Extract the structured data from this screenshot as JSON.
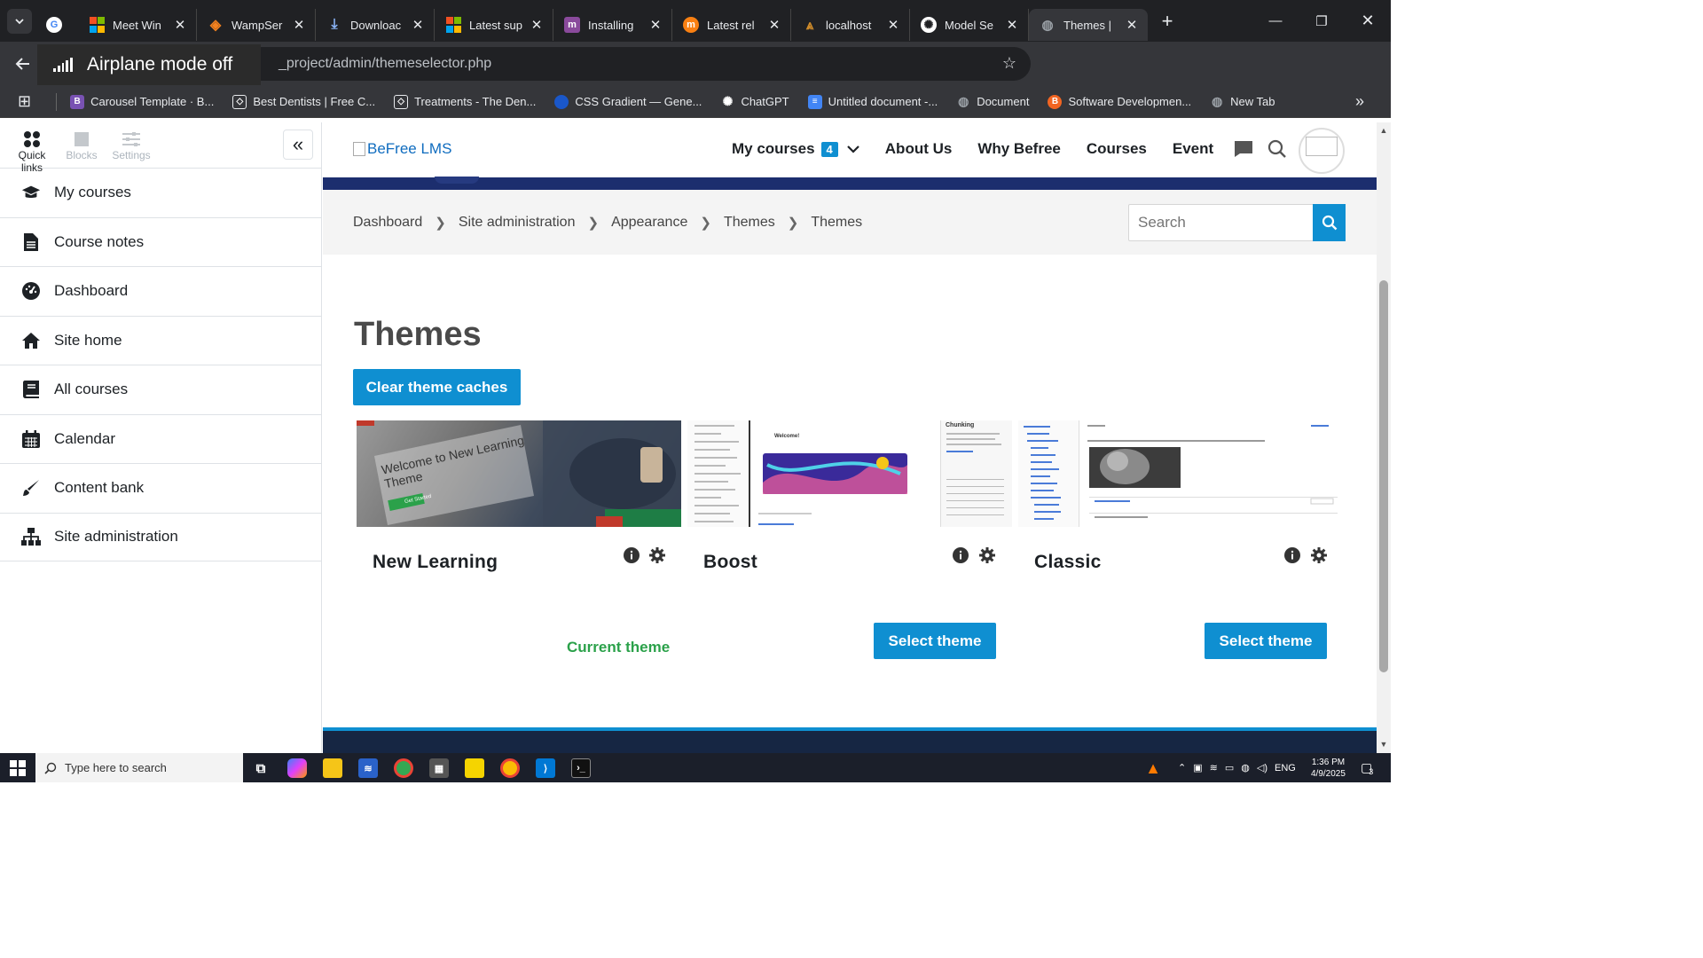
{
  "browser": {
    "tabs": [
      {
        "title": "Meet Win",
        "icon": "microsoft-icon",
        "color": "#f25022"
      },
      {
        "title": "WampSer",
        "icon": "wamp-icon",
        "color": "#f5821f"
      },
      {
        "title": "Downloac",
        "icon": "download-icon",
        "color": "#8ab4f8"
      },
      {
        "title": "Latest sup",
        "icon": "microsoft-icon",
        "color": "#7fba00"
      },
      {
        "title": "Installing",
        "icon": "moodle-icon",
        "color": "#8a4a9c"
      },
      {
        "title": "Latest rel",
        "icon": "moodle-icon",
        "color": "#f98012"
      },
      {
        "title": "localhost",
        "icon": "localhost-icon",
        "color": "#d08c2a"
      },
      {
        "title": "Model Se",
        "icon": "openai-icon",
        "color": "#ffffff"
      },
      {
        "title": "Themes |",
        "icon": "globe-icon",
        "color": "#9aa0a6",
        "active": true
      }
    ],
    "url": "_project/admin/themeselector.php",
    "airplane_toast": "Airplane mode off",
    "bookmarks": [
      {
        "label": "Carousel Template · B...",
        "color": "#7952b3",
        "glyph": "B"
      },
      {
        "label": "Best Dentists | Free C...",
        "color": "#ffffff",
        "glyph": "◇"
      },
      {
        "label": "Treatments - The Den...",
        "color": "#ffffff",
        "glyph": "◇"
      },
      {
        "label": "CSS Gradient — Gene...",
        "color": "#1a57c9",
        "glyph": ""
      },
      {
        "label": "ChatGPT",
        "color": "#ffffff",
        "glyph": "✺"
      },
      {
        "label": "Untitled document -...",
        "color": "#4285f4",
        "glyph": "≡"
      },
      {
        "label": "Document",
        "color": "#9aa0a6",
        "glyph": "◍"
      },
      {
        "label": "Software Developmen...",
        "color": "#f26522",
        "glyph": "B"
      },
      {
        "label": "New Tab",
        "color": "#9aa0a6",
        "glyph": "◍"
      }
    ]
  },
  "drawer": {
    "tabs": [
      {
        "label": "Quick links",
        "active": true
      },
      {
        "label": "Blocks"
      },
      {
        "label": "Settings"
      }
    ],
    "items": [
      {
        "label": "My courses",
        "icon": "graduation-cap-icon"
      },
      {
        "label": "Course notes",
        "icon": "document-icon"
      },
      {
        "label": "Dashboard",
        "icon": "dashboard-gauge-icon"
      },
      {
        "label": "Site home",
        "icon": "home-icon"
      },
      {
        "label": "All courses",
        "icon": "book-icon"
      },
      {
        "label": "Calendar",
        "icon": "calendar-icon"
      },
      {
        "label": "Content bank",
        "icon": "brush-icon"
      },
      {
        "label": "Site administration",
        "icon": "sitemap-icon"
      }
    ]
  },
  "navbar": {
    "logo_alt": "BeFree LMS",
    "links": [
      {
        "label": "My courses",
        "badge": "4",
        "dropdown": true
      },
      {
        "label": "About Us"
      },
      {
        "label": "Why Befree"
      },
      {
        "label": "Courses"
      },
      {
        "label": "Event"
      }
    ]
  },
  "breadcrumb": [
    "Dashboard",
    "Site administration",
    "Appearance",
    "Themes",
    "Themes"
  ],
  "search": {
    "placeholder": "Search"
  },
  "page": {
    "title": "Themes",
    "clear_caches": "Clear theme caches",
    "themes": [
      {
        "name": "New Learning",
        "status": "Current theme",
        "thumb_caption": "Welcome to New Learning Theme",
        "thumb_cta": "Get Started"
      },
      {
        "name": "Boost",
        "action": "Select theme",
        "thumb_caption": "Welcome!",
        "thumb_side": "Chunking"
      },
      {
        "name": "Classic",
        "action": "Select theme"
      }
    ]
  },
  "taskbar": {
    "search_placeholder": "Type here to search",
    "lang": "ENG",
    "time": "1:36 PM",
    "date": "4/9/2025",
    "notifications": "3"
  },
  "colors": {
    "accent": "#0f8fd1",
    "success": "#2ba14a",
    "hero": "#1c2e6e"
  }
}
